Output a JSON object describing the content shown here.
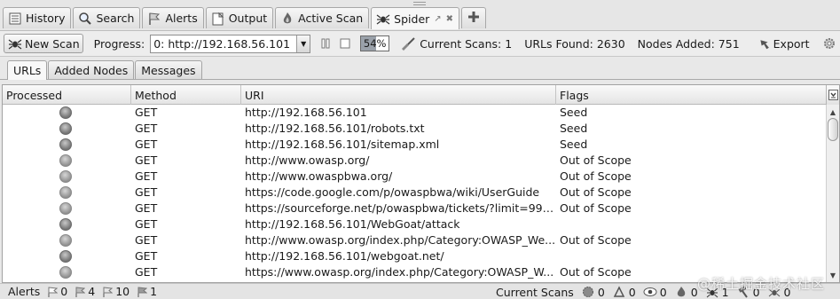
{
  "tabs": [
    {
      "label": "History",
      "icon": "history-icon"
    },
    {
      "label": "Search",
      "icon": "search-icon"
    },
    {
      "label": "Alerts",
      "icon": "flag-icon"
    },
    {
      "label": "Output",
      "icon": "output-icon"
    },
    {
      "label": "Active Scan",
      "icon": "active-scan-icon"
    },
    {
      "label": "Spider",
      "icon": "spider-icon",
      "active": true
    }
  ],
  "toolbar": {
    "new_scan_label": "New Scan",
    "progress_label": "Progress:",
    "progress_select_value": "0: http://192.168.56.101",
    "progress_percent": 54,
    "progress_text": "54%",
    "current_scans_label": "Current Scans:",
    "current_scans_value": "1",
    "urls_found_label": "URLs Found:",
    "urls_found_value": "2630",
    "nodes_added_label": "Nodes Added:",
    "nodes_added_value": "751",
    "export_label": "Export"
  },
  "subtabs": [
    {
      "label": "URLs",
      "active": true
    },
    {
      "label": "Added Nodes"
    },
    {
      "label": "Messages"
    }
  ],
  "table": {
    "columns": [
      "Processed",
      "Method",
      "URI",
      "Flags"
    ],
    "rows": [
      {
        "processed": "dark",
        "method": "GET",
        "uri": "http://192.168.56.101",
        "flags": "Seed"
      },
      {
        "processed": "dark",
        "method": "GET",
        "uri": "http://192.168.56.101/robots.txt",
        "flags": "Seed"
      },
      {
        "processed": "dark",
        "method": "GET",
        "uri": "http://192.168.56.101/sitemap.xml",
        "flags": "Seed"
      },
      {
        "processed": "light",
        "method": "GET",
        "uri": "http://www.owasp.org/",
        "flags": "Out of Scope"
      },
      {
        "processed": "light",
        "method": "GET",
        "uri": "http://www.owaspbwa.org/",
        "flags": "Out of Scope"
      },
      {
        "processed": "light",
        "method": "GET",
        "uri": "https://code.google.com/p/owaspbwa/wiki/UserGuide",
        "flags": "Out of Scope"
      },
      {
        "processed": "light",
        "method": "GET",
        "uri": "https://sourceforge.net/p/owaspbwa/tickets/?limit=999...",
        "flags": "Out of Scope"
      },
      {
        "processed": "dark",
        "method": "GET",
        "uri": "http://192.168.56.101/WebGoat/attack",
        "flags": ""
      },
      {
        "processed": "light",
        "method": "GET",
        "uri": "http://www.owasp.org/index.php/Category:OWASP_We...",
        "flags": "Out of Scope"
      },
      {
        "processed": "dark",
        "method": "GET",
        "uri": "http://192.168.56.101/webgoat.net/",
        "flags": ""
      },
      {
        "processed": "light",
        "method": "GET",
        "uri": "https://www.owasp.org/index.php/Category:OWASP_W...",
        "flags": "Out of Scope"
      }
    ]
  },
  "statusbar": {
    "alerts_label": "Alerts",
    "alert_counts": [
      {
        "level": "high",
        "value": "0"
      },
      {
        "level": "medium",
        "value": "4"
      },
      {
        "level": "low",
        "value": "10"
      },
      {
        "level": "info",
        "value": "1"
      }
    ],
    "current_scans_label": "Current Scans",
    "scan_counts": [
      {
        "type": "active-scan",
        "value": "0"
      },
      {
        "type": "break",
        "value": "0"
      },
      {
        "type": "watch",
        "value": "0"
      },
      {
        "type": "fuzzer",
        "value": "0"
      },
      {
        "type": "spider",
        "value": "1"
      },
      {
        "type": "forced-browse",
        "value": "0"
      },
      {
        "type": "ajax-spider",
        "value": "0"
      }
    ]
  },
  "watermark": "@稀土掘金技术社区",
  "colors": {
    "accent_blue": "#3b6fb6",
    "flag_red": "#c0392b",
    "flag_orange": "#e08a1e",
    "flag_yellow": "#e6c619",
    "flag_blue": "#3a78c2"
  }
}
